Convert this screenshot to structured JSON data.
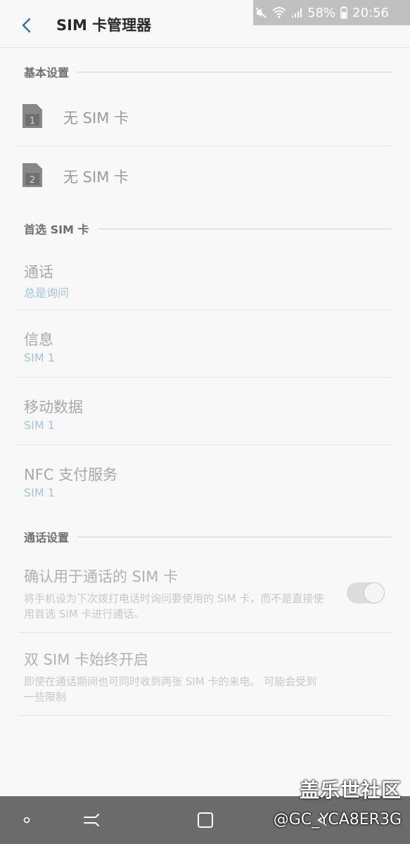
{
  "status_bar": {
    "battery": "58%",
    "time": "20:56"
  },
  "header": {
    "title": "SIM 卡管理器"
  },
  "sections": {
    "basic": {
      "label": "基本设置"
    },
    "preferred": {
      "label": "首选 SIM 卡"
    },
    "call_settings": {
      "label": "通话设置"
    }
  },
  "sims": [
    {
      "slot": "1",
      "label": "无 SIM 卡"
    },
    {
      "slot": "2",
      "label": "无 SIM 卡"
    }
  ],
  "preferred_items": [
    {
      "title": "通话",
      "value": "总是询问"
    },
    {
      "title": "信息",
      "value": "SIM 1"
    },
    {
      "title": "移动数据",
      "value": "SIM 1"
    },
    {
      "title": "NFC 支付服务",
      "value": "SIM 1"
    }
  ],
  "call_items": [
    {
      "title": "确认用于通话的 SIM 卡",
      "desc": "将手机设为下次拨打电话时询问要使用的 SIM 卡，而不是直接使用首选 SIM 卡进行通话。",
      "toggle_on": true
    },
    {
      "title": "双 SIM 卡始终开启",
      "desc": "即使在通话期间也可同时收到两张 SIM 卡的来电。 可能会受到一些限制"
    }
  ],
  "watermark": {
    "site": "盖乐世社区",
    "user": "@GC_YCA8ER3G"
  },
  "colors": {
    "accent": "#9fc5df",
    "background": "#f8f8f8",
    "nav_bar": "#6b6b6b"
  }
}
